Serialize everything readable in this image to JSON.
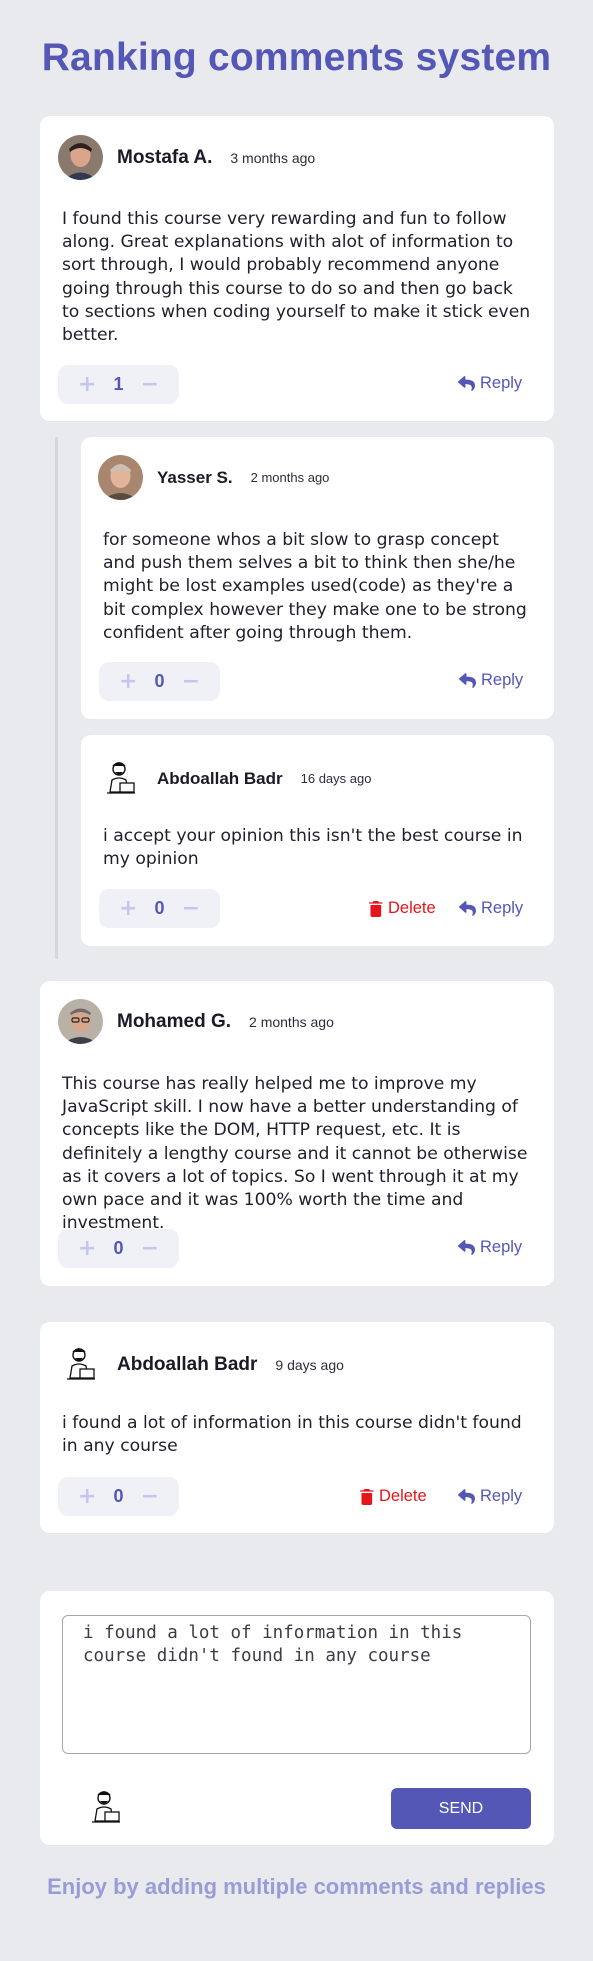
{
  "page": {
    "title": "Ranking comments system",
    "footer": "Enjoy by adding multiple comments and replies"
  },
  "colors": {
    "accent": "#5457b6",
    "delete": "#e5151b",
    "background": "#e9eaee",
    "card": "#ffffff",
    "vote_bg": "#f0f1f7"
  },
  "icons": {
    "upvote": "plus-icon",
    "downvote": "minus-icon",
    "reply": "reply-icon",
    "delete": "trash-icon"
  },
  "comments": [
    {
      "user": "Mostafa A.",
      "time": "3 months ago",
      "text": "I found this course very rewarding and fun to follow along. Great explanations with alot of information to sort through, I would probably recommend anyone going through this course to do so and then go back to sections when coding yourself to make it stick even better.",
      "score": "1",
      "reply_label": "Reply",
      "replies": [
        {
          "user": "Yasser S.",
          "time": "2 months ago",
          "text": "for someone whos a bit slow to grasp concept and push them selves a bit to think then she/he might be lost examples used(code) as they're a bit complex however they make one to be strong confident after going through them.",
          "score": "0",
          "reply_label": "Reply"
        },
        {
          "user": "Abdoallah Badr",
          "time": "16 days ago",
          "text": "i accept your opinion this isn't the best course in my opinion",
          "score": "0",
          "delete_label": "Delete",
          "reply_label": "Reply"
        }
      ]
    },
    {
      "user": "Mohamed G.",
      "time": "2 months ago",
      "text": "This course has really helped me to improve my JavaScript skill. I now have a better understanding of concepts like the DOM, HTTP request, etc. It is definitely a lengthy course and it cannot be otherwise as it covers a lot of topics. So I went through it at my own pace and it was 100% worth the time and investment.",
      "score": "0",
      "reply_label": "Reply"
    },
    {
      "user": "Abdoallah Badr",
      "time": "9 days ago",
      "text": "i found a lot of information in this course didn't found in any course",
      "score": "0",
      "delete_label": "Delete",
      "reply_label": "Reply"
    }
  ],
  "composer": {
    "value": "i found a lot of information in this course didn't found in any course",
    "send_label": "SEND"
  }
}
